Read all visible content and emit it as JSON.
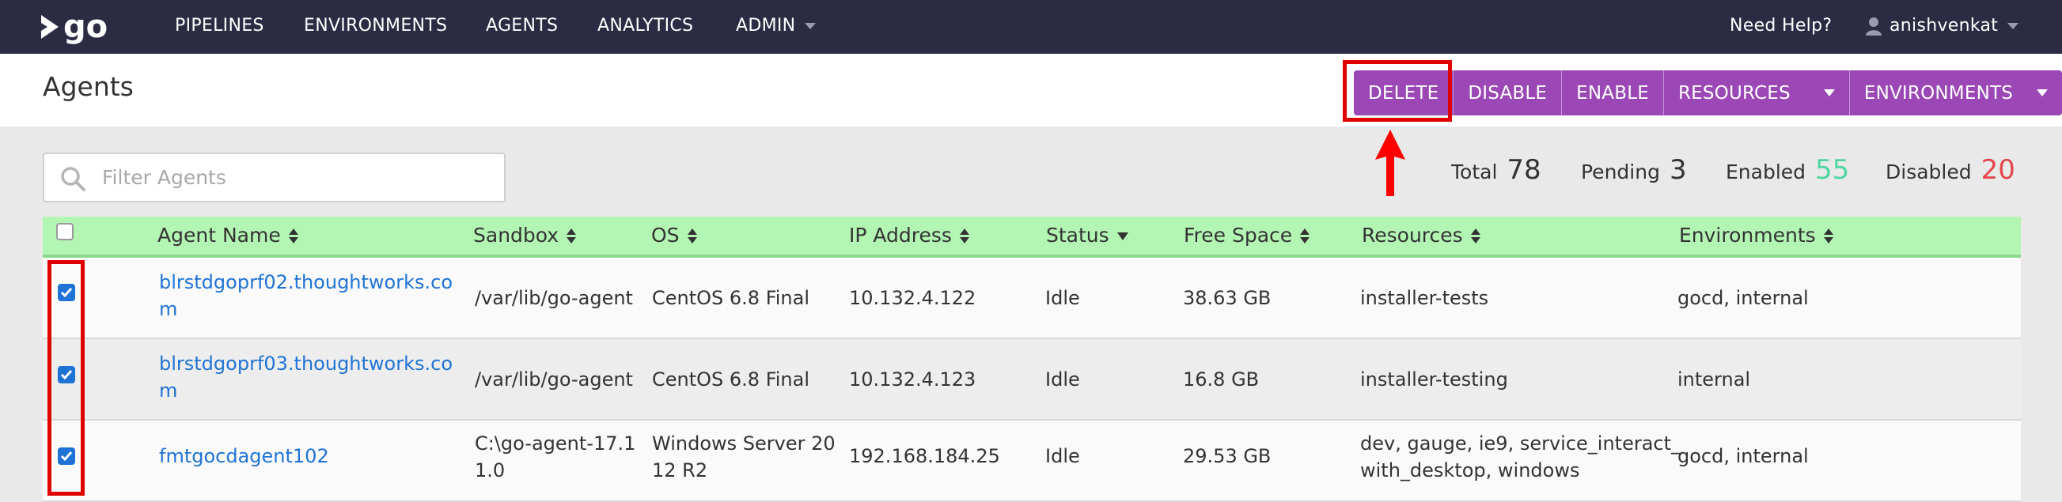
{
  "nav": {
    "logo_text": "go",
    "items": [
      {
        "label": "PIPELINES"
      },
      {
        "label": "ENVIRONMENTS"
      },
      {
        "label": "AGENTS"
      },
      {
        "label": "ANALYTICS"
      },
      {
        "label": "ADMIN"
      }
    ],
    "help_label": "Need Help?",
    "username": "anishvenkat"
  },
  "header": {
    "title": "Agents",
    "actions": [
      {
        "label": "DELETE"
      },
      {
        "label": "DISABLE"
      },
      {
        "label": "ENABLE"
      },
      {
        "label": "RESOURCES"
      },
      {
        "label": "ENVIRONMENTS"
      }
    ]
  },
  "filter": {
    "placeholder": "Filter Agents"
  },
  "stats": {
    "total_label": "Total",
    "total_value": "78",
    "pending_label": "Pending",
    "pending_value": "3",
    "enabled_label": "Enabled",
    "enabled_value": "55",
    "disabled_label": "Disabled",
    "disabled_value": "20"
  },
  "table": {
    "columns": [
      "Agent Name",
      "Sandbox",
      "OS",
      "IP Address",
      "Status",
      "Free Space",
      "Resources",
      "Environments"
    ],
    "rows": [
      {
        "name": [
          "blrstdgoprf02.thoughtworks.co",
          "m"
        ],
        "sandbox": [
          "/var/lib/go-agent"
        ],
        "os": [
          "CentOS 6.8 Final"
        ],
        "ip": "10.132.4.122",
        "status": "Idle",
        "free_space": "38.63 GB",
        "resources": [
          "installer-tests"
        ],
        "environments": "gocd, internal"
      },
      {
        "name": [
          "blrstdgoprf03.thoughtworks.co",
          "m"
        ],
        "sandbox": [
          "/var/lib/go-agent"
        ],
        "os": [
          "CentOS 6.8 Final"
        ],
        "ip": "10.132.4.123",
        "status": "Idle",
        "free_space": "16.8 GB",
        "resources": [
          "installer-testing"
        ],
        "environments": "internal"
      },
      {
        "name": [
          "fmtgocdagent102"
        ],
        "sandbox": [
          "C:\\go-agent-17.1",
          "1.0"
        ],
        "os": [
          "Windows Server 20",
          "12 R2"
        ],
        "ip": "192.168.184.25",
        "status": "Idle",
        "free_space": "29.53 GB",
        "resources": [
          "dev, gauge, ie9, service_interact_",
          "with_desktop, windows"
        ],
        "environments": "gocd, internal"
      }
    ]
  },
  "colors": {
    "nav_bg": "#2b2c43",
    "action_purple": "#9b47b6",
    "header_green": "#b3f5b3",
    "enabled_green": "#4fd6a0",
    "disabled_red": "#e5454c",
    "link_blue": "#1f73d6",
    "annotation_red": "#e00000"
  }
}
